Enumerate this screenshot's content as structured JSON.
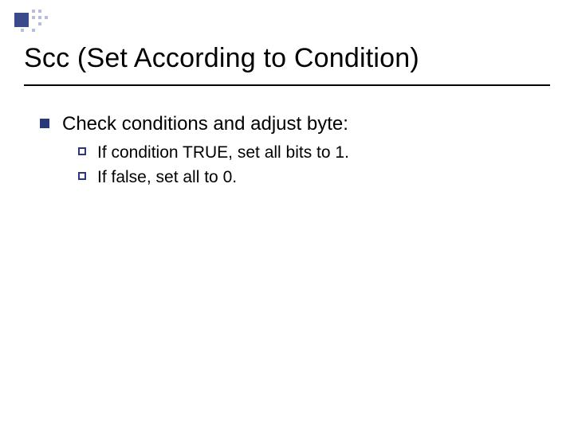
{
  "title": "Scc (Set According to Condition)",
  "body": {
    "item1": {
      "text": "Check conditions and adjust byte:",
      "sub": [
        "If condition TRUE, set all bits to 1.",
        "If false, set all to 0."
      ]
    }
  }
}
